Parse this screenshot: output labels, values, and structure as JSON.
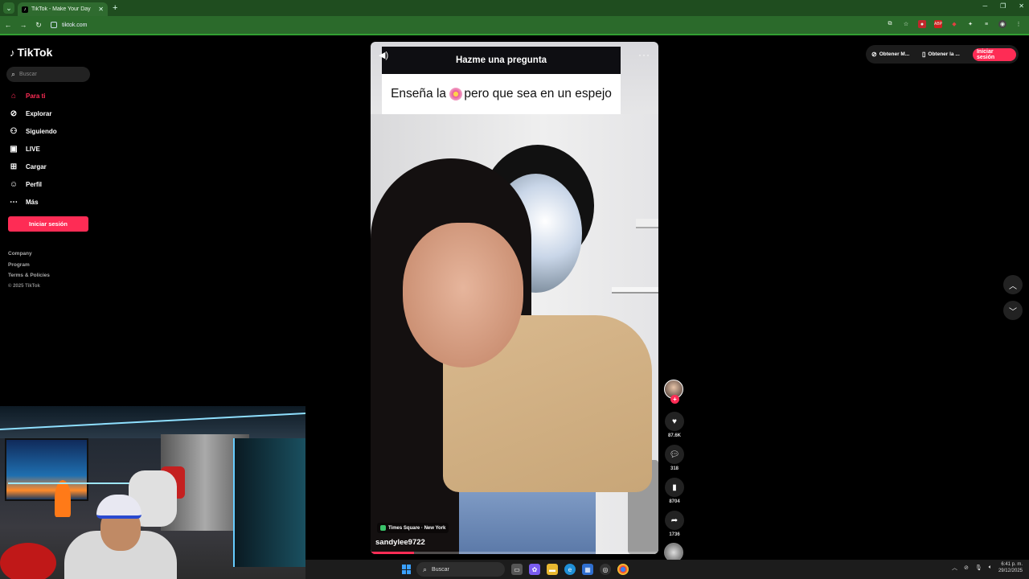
{
  "browser": {
    "tab_title": "TikTok - Make Your Day",
    "tab_close": "✕",
    "new_tab": "+",
    "url": "tiktok.com",
    "accent": "#2b6a2b"
  },
  "sidebar": {
    "logo": "TikTok",
    "search_placeholder": "Buscar",
    "items": [
      {
        "label": "Para ti",
        "icon": "home-icon",
        "active": true
      },
      {
        "label": "Explorar",
        "icon": "compass-icon"
      },
      {
        "label": "Siguiendo",
        "icon": "following-icon"
      },
      {
        "label": "LIVE",
        "icon": "live-icon"
      },
      {
        "label": "Cargar",
        "icon": "upload-icon"
      },
      {
        "label": "Perfil",
        "icon": "profile-icon"
      },
      {
        "label": "Más",
        "icon": "more-icon"
      }
    ],
    "login": "Iniciar sesión",
    "footer": [
      "Company",
      "Program",
      "Terms & Policies"
    ],
    "copyright": "© 2025 TikTok"
  },
  "video": {
    "question_header": "Hazme una pregunta",
    "question_text_before": "Enseña la",
    "question_text_after": "pero que sea en un espejo",
    "location": "Times Square · New York",
    "username": "sandylee9722",
    "progress": 0.15
  },
  "actions": {
    "likes": "87.6K",
    "comments": "318",
    "saves": "8704",
    "shares": "1736"
  },
  "top_right": {
    "btn1": "Obtener M...",
    "btn2": "Obtener la ...",
    "login": "Iniciar sesión"
  },
  "taskbar": {
    "search": "Buscar",
    "time": "6:41 p. m.",
    "date": "29/12/2025"
  },
  "colors": {
    "brand": "#fe2c55",
    "background": "#000000"
  }
}
